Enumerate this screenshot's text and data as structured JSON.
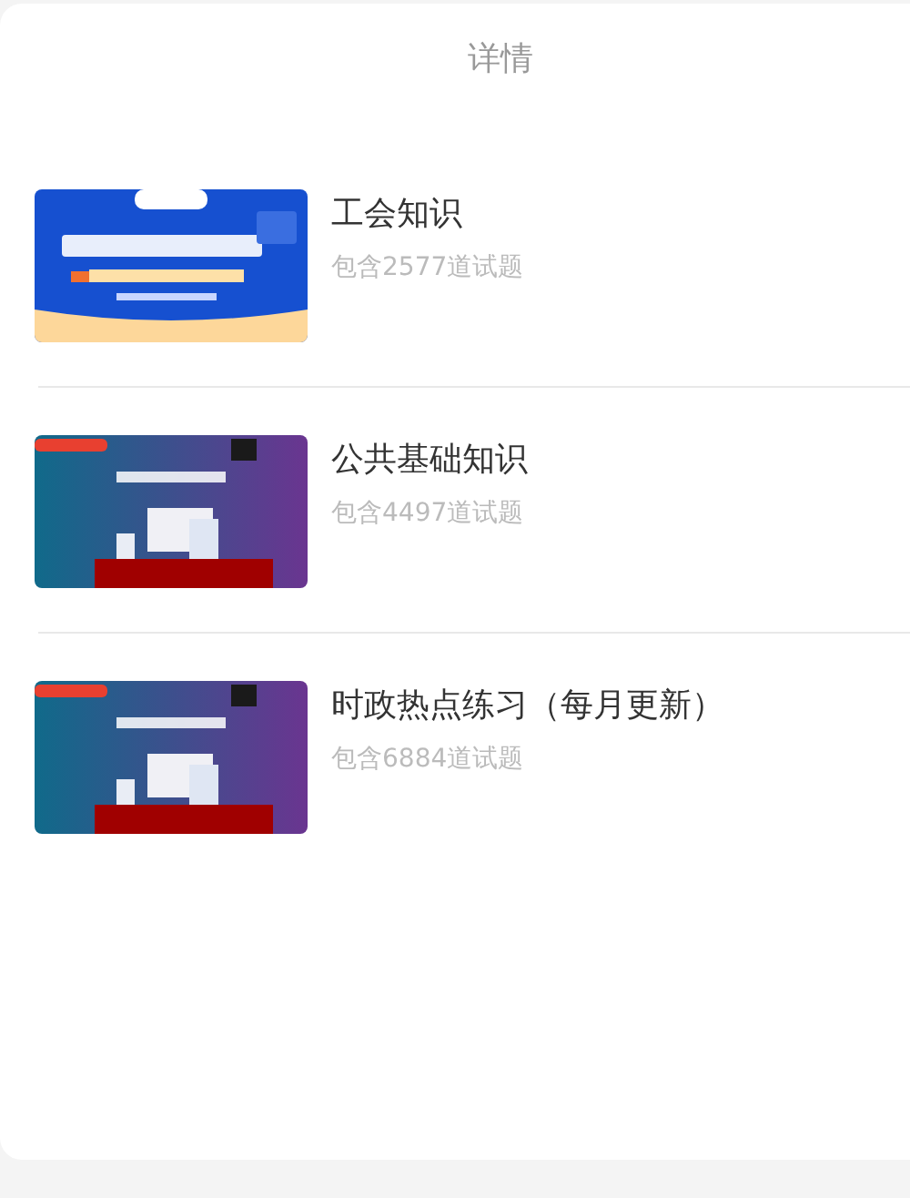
{
  "header": {
    "title": "详情"
  },
  "items": [
    {
      "title": "工会知识",
      "subtitle": "包含2577道试题"
    },
    {
      "title": "公共基础知识",
      "subtitle": "包含4497道试题"
    },
    {
      "title": "时政热点练习（每月更新）",
      "subtitle": "包含6884道试题"
    }
  ]
}
